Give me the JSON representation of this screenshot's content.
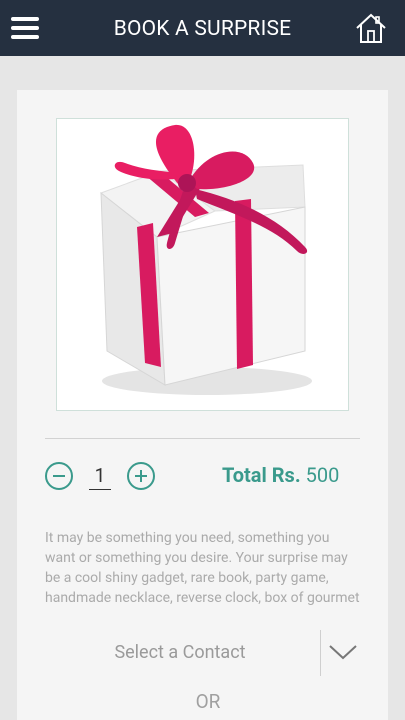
{
  "header": {
    "title": "BOOK A SURPRISE",
    "menu_icon": "hamburger-menu-icon",
    "home_icon": "home-icon",
    "background": "#253040"
  },
  "product": {
    "image": "gift-box-image",
    "ribbon_color": "#d81b60"
  },
  "quantity": {
    "value": "1",
    "minus_icon": "minus-circle-icon",
    "plus_icon": "plus-circle-icon"
  },
  "total": {
    "label": "Total Rs.",
    "amount": "500",
    "accent": "#3a9a8c"
  },
  "description": "It may be something you need, something you\nwant or something you desire. Your surprise may\nbe a cool shiny gadget, rare book, party game,\nhandmade necklace, reverse clock, box of gourmet",
  "contact_select": {
    "placeholder": "Select a Contact",
    "chevron_icon": "chevron-down-icon"
  },
  "or_label": "OR"
}
